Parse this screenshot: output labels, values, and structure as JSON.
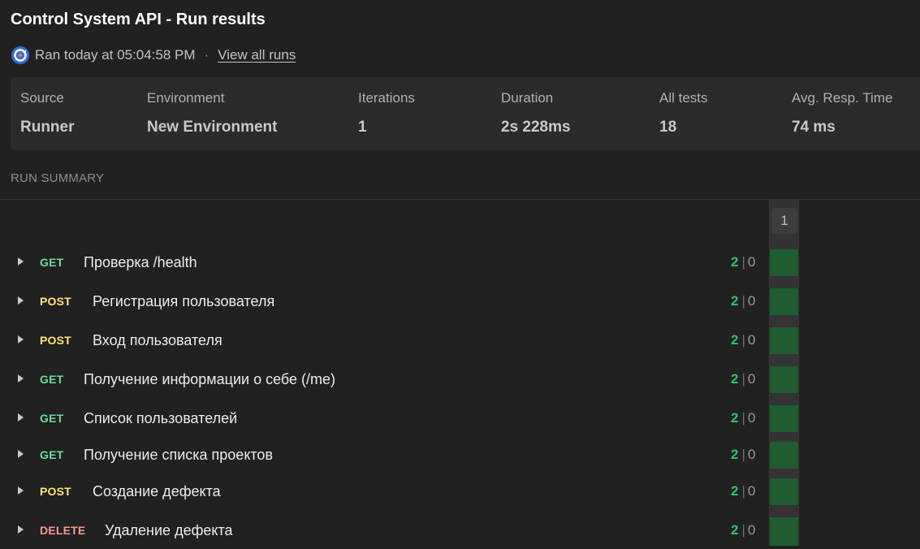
{
  "header": {
    "title": "Control System API - Run results",
    "ran_text": "Ran today at 05:04:58 PM",
    "separator": "·",
    "view_all_runs": "View all runs"
  },
  "stats": [
    {
      "label": "Source",
      "value": "Runner"
    },
    {
      "label": "Environment",
      "value": "New Environment"
    },
    {
      "label": "Iterations",
      "value": "1"
    },
    {
      "label": "Duration",
      "value": "2s 228ms"
    },
    {
      "label": "All tests",
      "value": "18"
    },
    {
      "label": "Avg. Resp. Time",
      "value": "74 ms"
    }
  ],
  "summary": {
    "heading": "RUN SUMMARY",
    "iteration_label": "1",
    "requests": [
      {
        "method": "GET",
        "name": "Проверка /health",
        "passed": "2",
        "failed": "0"
      },
      {
        "method": "POST",
        "name": "Регистрация пользователя",
        "passed": "2",
        "failed": "0"
      },
      {
        "method": "POST",
        "name": "Вход пользователя",
        "passed": "2",
        "failed": "0"
      },
      {
        "method": "GET",
        "name": "Получение информации о себе (/me)",
        "passed": "2",
        "failed": "0"
      },
      {
        "method": "GET",
        "name": "Список пользователей",
        "passed": "2",
        "failed": "0"
      },
      {
        "method": "GET",
        "name": "Получение списка проектов",
        "passed": "2",
        "failed": "0"
      },
      {
        "method": "POST",
        "name": "Создание дефекта",
        "passed": "2",
        "failed": "0"
      },
      {
        "method": "DELETE",
        "name": "Удаление дефекта",
        "passed": "2",
        "failed": "0"
      }
    ]
  },
  "colors": {
    "get": "#6bdd9a",
    "post": "#ffe47e",
    "delete": "#f79a8e",
    "pass_cell": "#1f5c2f"
  }
}
